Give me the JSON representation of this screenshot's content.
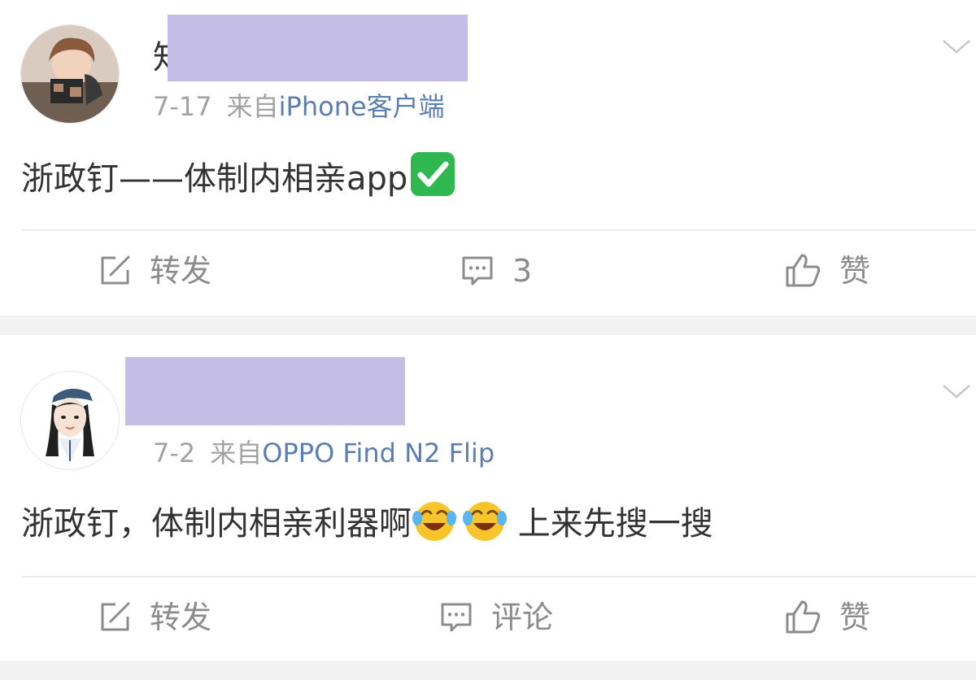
{
  "posts": [
    {
      "username_visible": "知",
      "date": "7-17",
      "source_prefix": "来自",
      "source": "iPhone客户端",
      "content_text": "浙政钉——体制内相亲app",
      "content_emoji": "check-mark-button-emoji",
      "actions": {
        "repost_label": "转发",
        "comment_label": "3",
        "like_label": "赞"
      }
    },
    {
      "date": "7-2",
      "source_prefix": "来自",
      "source": "OPPO Find N2 Flip",
      "content_text_before": "浙政钉，体制内相亲利器啊",
      "content_emoji": "face-with-tears-of-joy-emoji",
      "content_text_after": " 上来先搜一搜",
      "actions": {
        "repost_label": "转发",
        "comment_label": "评论",
        "like_label": "赞"
      }
    }
  ],
  "colors": {
    "background": "#f2f2f2",
    "card": "#ffffff",
    "text_primary": "#333333",
    "text_meta": "#a3a3a3",
    "source_link": "#5b7fb0",
    "action_text": "#8c8c8c",
    "redaction": "#c4bde6",
    "check_green": "#2fb84f",
    "emoji_yellow": "#f7c52b"
  },
  "icons": {
    "repost": "edit-square-icon",
    "comment": "comment-bubble-icon",
    "like": "thumbs-up-icon",
    "more": "chevron-down-icon"
  }
}
